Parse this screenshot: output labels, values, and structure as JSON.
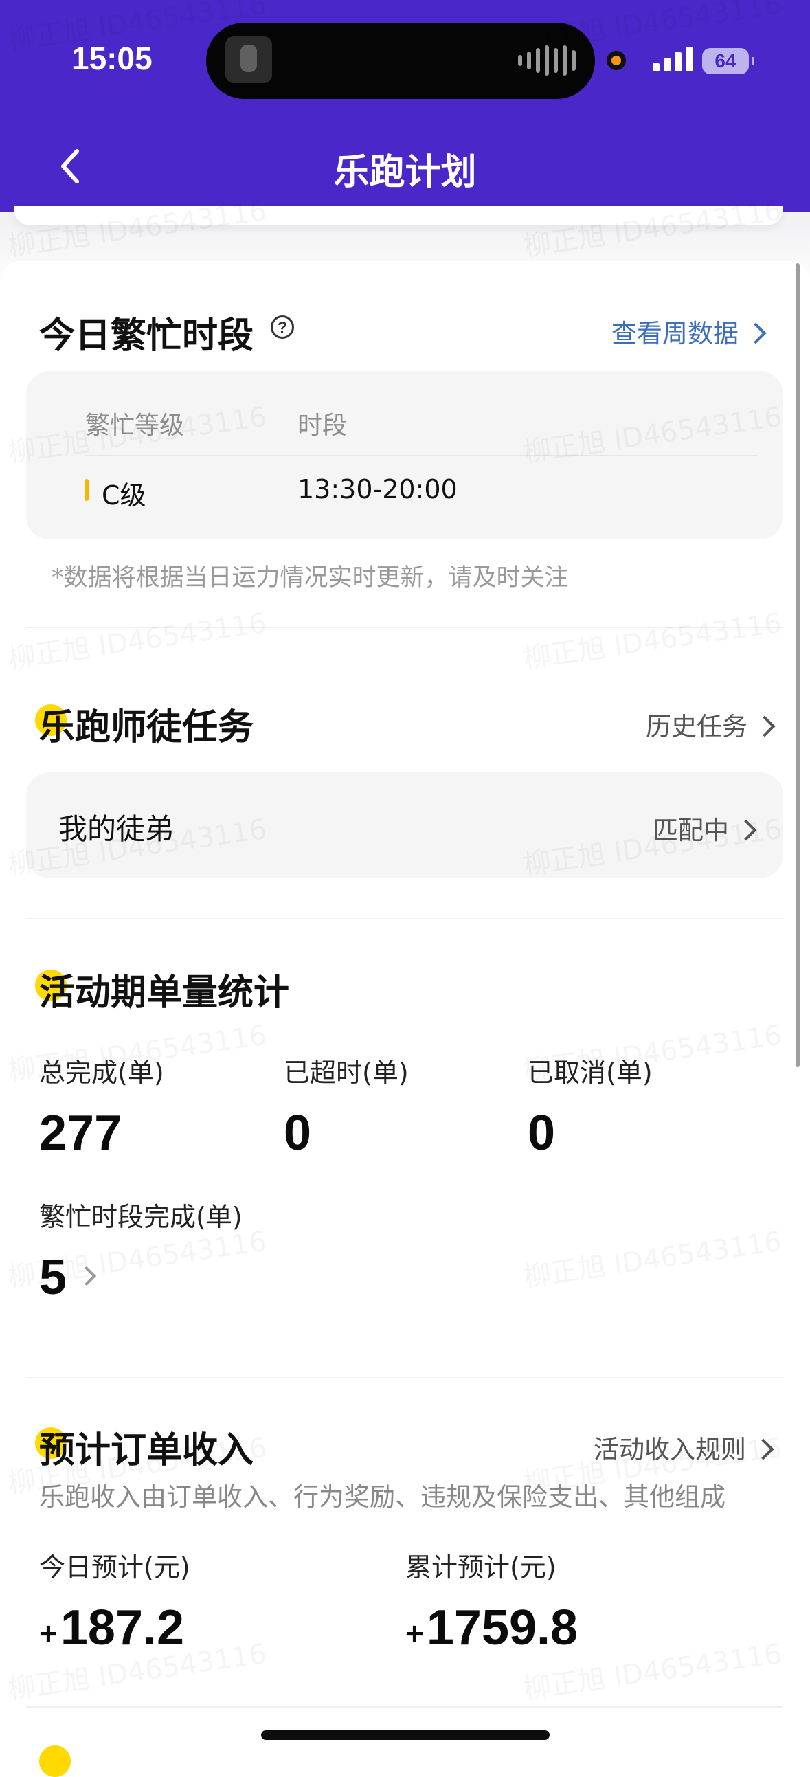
{
  "status_bar": {
    "time": "15:05",
    "battery": "64"
  },
  "nav": {
    "title": "乐跑计划",
    "back_icon": "chevron-left-icon"
  },
  "busy_period": {
    "title": "今日繁忙时段",
    "help_icon": "question-circle-icon",
    "link": "查看周数据",
    "headers": [
      "繁忙等级",
      "时段"
    ],
    "rows": [
      {
        "level": "C级",
        "period": "13:30-20:00"
      }
    ],
    "note": "*数据将根据当日运力情况实时更新，请及时关注"
  },
  "mentor_task": {
    "title_first": "乐",
    "title_rest": "跑师徒任务",
    "link": "历史任务",
    "item_label": "我的徒弟",
    "item_status": "匹配中"
  },
  "order_stats": {
    "title_first": "活",
    "title_rest": "动期单量统计",
    "stats": [
      {
        "label": "总完成(单)",
        "value": "277"
      },
      {
        "label": "已超时(单)",
        "value": "0"
      },
      {
        "label": "已取消(单)",
        "value": "0"
      },
      {
        "label": "繁忙时段完成(单)",
        "value": "5"
      }
    ]
  },
  "income": {
    "title_first": "预",
    "title_rest": "计订单收入",
    "link": "活动收入规则",
    "description": "乐跑收入由订单收入、行为奖励、违规及保险支出、其他组成",
    "today_label": "今日预计(元)",
    "today_sign": "+",
    "today_value": "187.2",
    "total_label": "累计预计(元)",
    "total_sign": "+",
    "total_value": "1759.8"
  },
  "watermark": "柳正旭 ID46543116",
  "colors": {
    "header_bg": "#4a27c9",
    "accent_yellow": "#ffd900",
    "link_blue": "#3c6fbb"
  }
}
